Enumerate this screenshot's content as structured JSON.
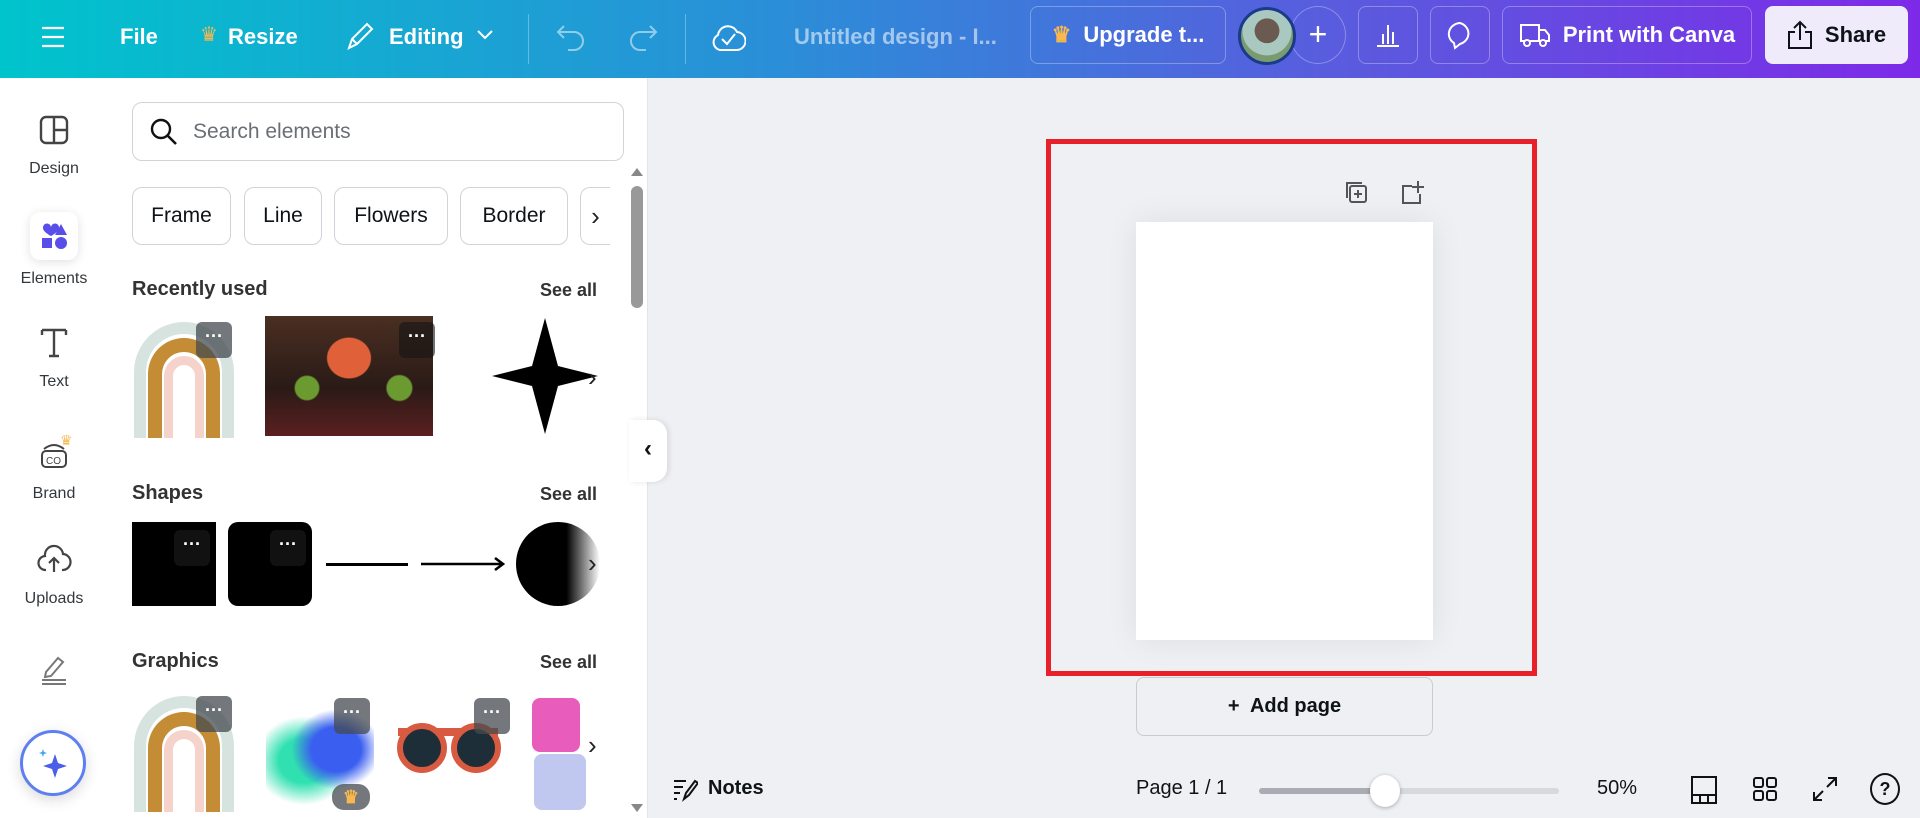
{
  "topbar": {
    "file": "File",
    "resize": "Resize",
    "editing": "Editing",
    "title": "Untitled design - I...",
    "upgrade": "Upgrade t...",
    "print": "Print with Canva",
    "share": "Share"
  },
  "rail": {
    "design": "Design",
    "elements": "Elements",
    "text": "Text",
    "brand": "Brand",
    "uploads": "Uploads"
  },
  "panel": {
    "search_placeholder": "Search elements",
    "chips": [
      "Frame",
      "Line",
      "Flowers",
      "Border"
    ],
    "sections": [
      {
        "title": "Recently used",
        "see_all": "See all"
      },
      {
        "title": "Shapes",
        "see_all": "See all"
      },
      {
        "title": "Graphics",
        "see_all": "See all"
      }
    ]
  },
  "canvas": {
    "add_page": "+  Add page"
  },
  "bottombar": {
    "notes": "Notes",
    "page": "Page 1 / 1",
    "zoom": "50%",
    "zoom_fraction": 0.42
  },
  "colors": {
    "highlight": "#e8202a",
    "accent": "#8b3dff"
  }
}
